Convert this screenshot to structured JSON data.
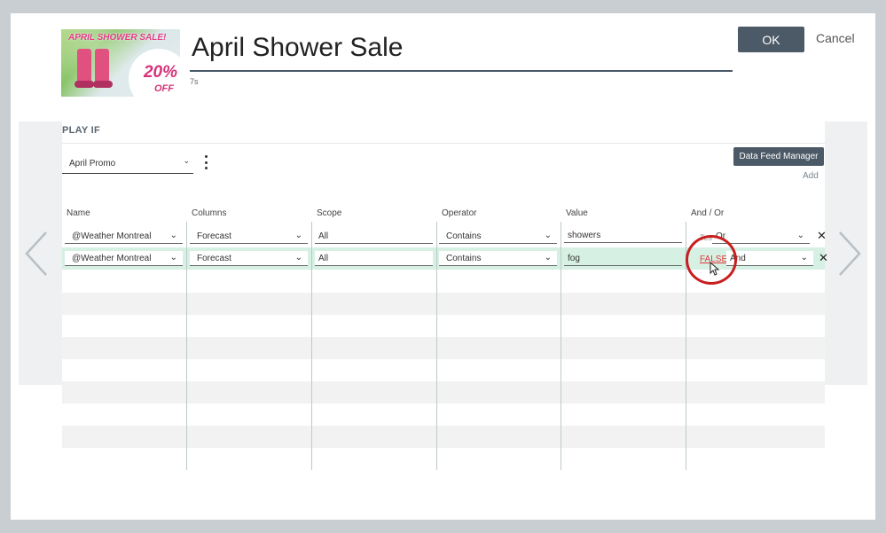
{
  "header": {
    "title": "April Shower Sale",
    "duration": "7s",
    "thumbnail": {
      "banner": "APRIL SHOWER SALE!",
      "discount_pct": "20%",
      "discount_off": "OFF"
    }
  },
  "actions": {
    "ok_label": "OK",
    "cancel_label": "Cancel"
  },
  "play_if": {
    "title": "PLAY IF",
    "promo_select": "April Promo",
    "data_feed_label": "Data Feed Manager",
    "add_label": "Add"
  },
  "columns": [
    "Name",
    "Columns",
    "Scope",
    "Operator",
    "Value",
    "And / Or"
  ],
  "rows": [
    {
      "name": "@Weather Montreal",
      "column": "Forecast",
      "scope": "All",
      "operator": "Contains",
      "value": "showers",
      "test_label": "Test",
      "and_or": "Or"
    },
    {
      "name": "@Weather Montreal",
      "column": "Forecast",
      "scope": "All",
      "operator": "Contains",
      "value": "fog",
      "test_result": "FALSE",
      "and_or": "And"
    }
  ],
  "colors": {
    "primary_button": "#4c5966",
    "highlight_row": "#d6f0e4",
    "annotation": "#c81e1e",
    "false_text": "#e23a3a"
  }
}
